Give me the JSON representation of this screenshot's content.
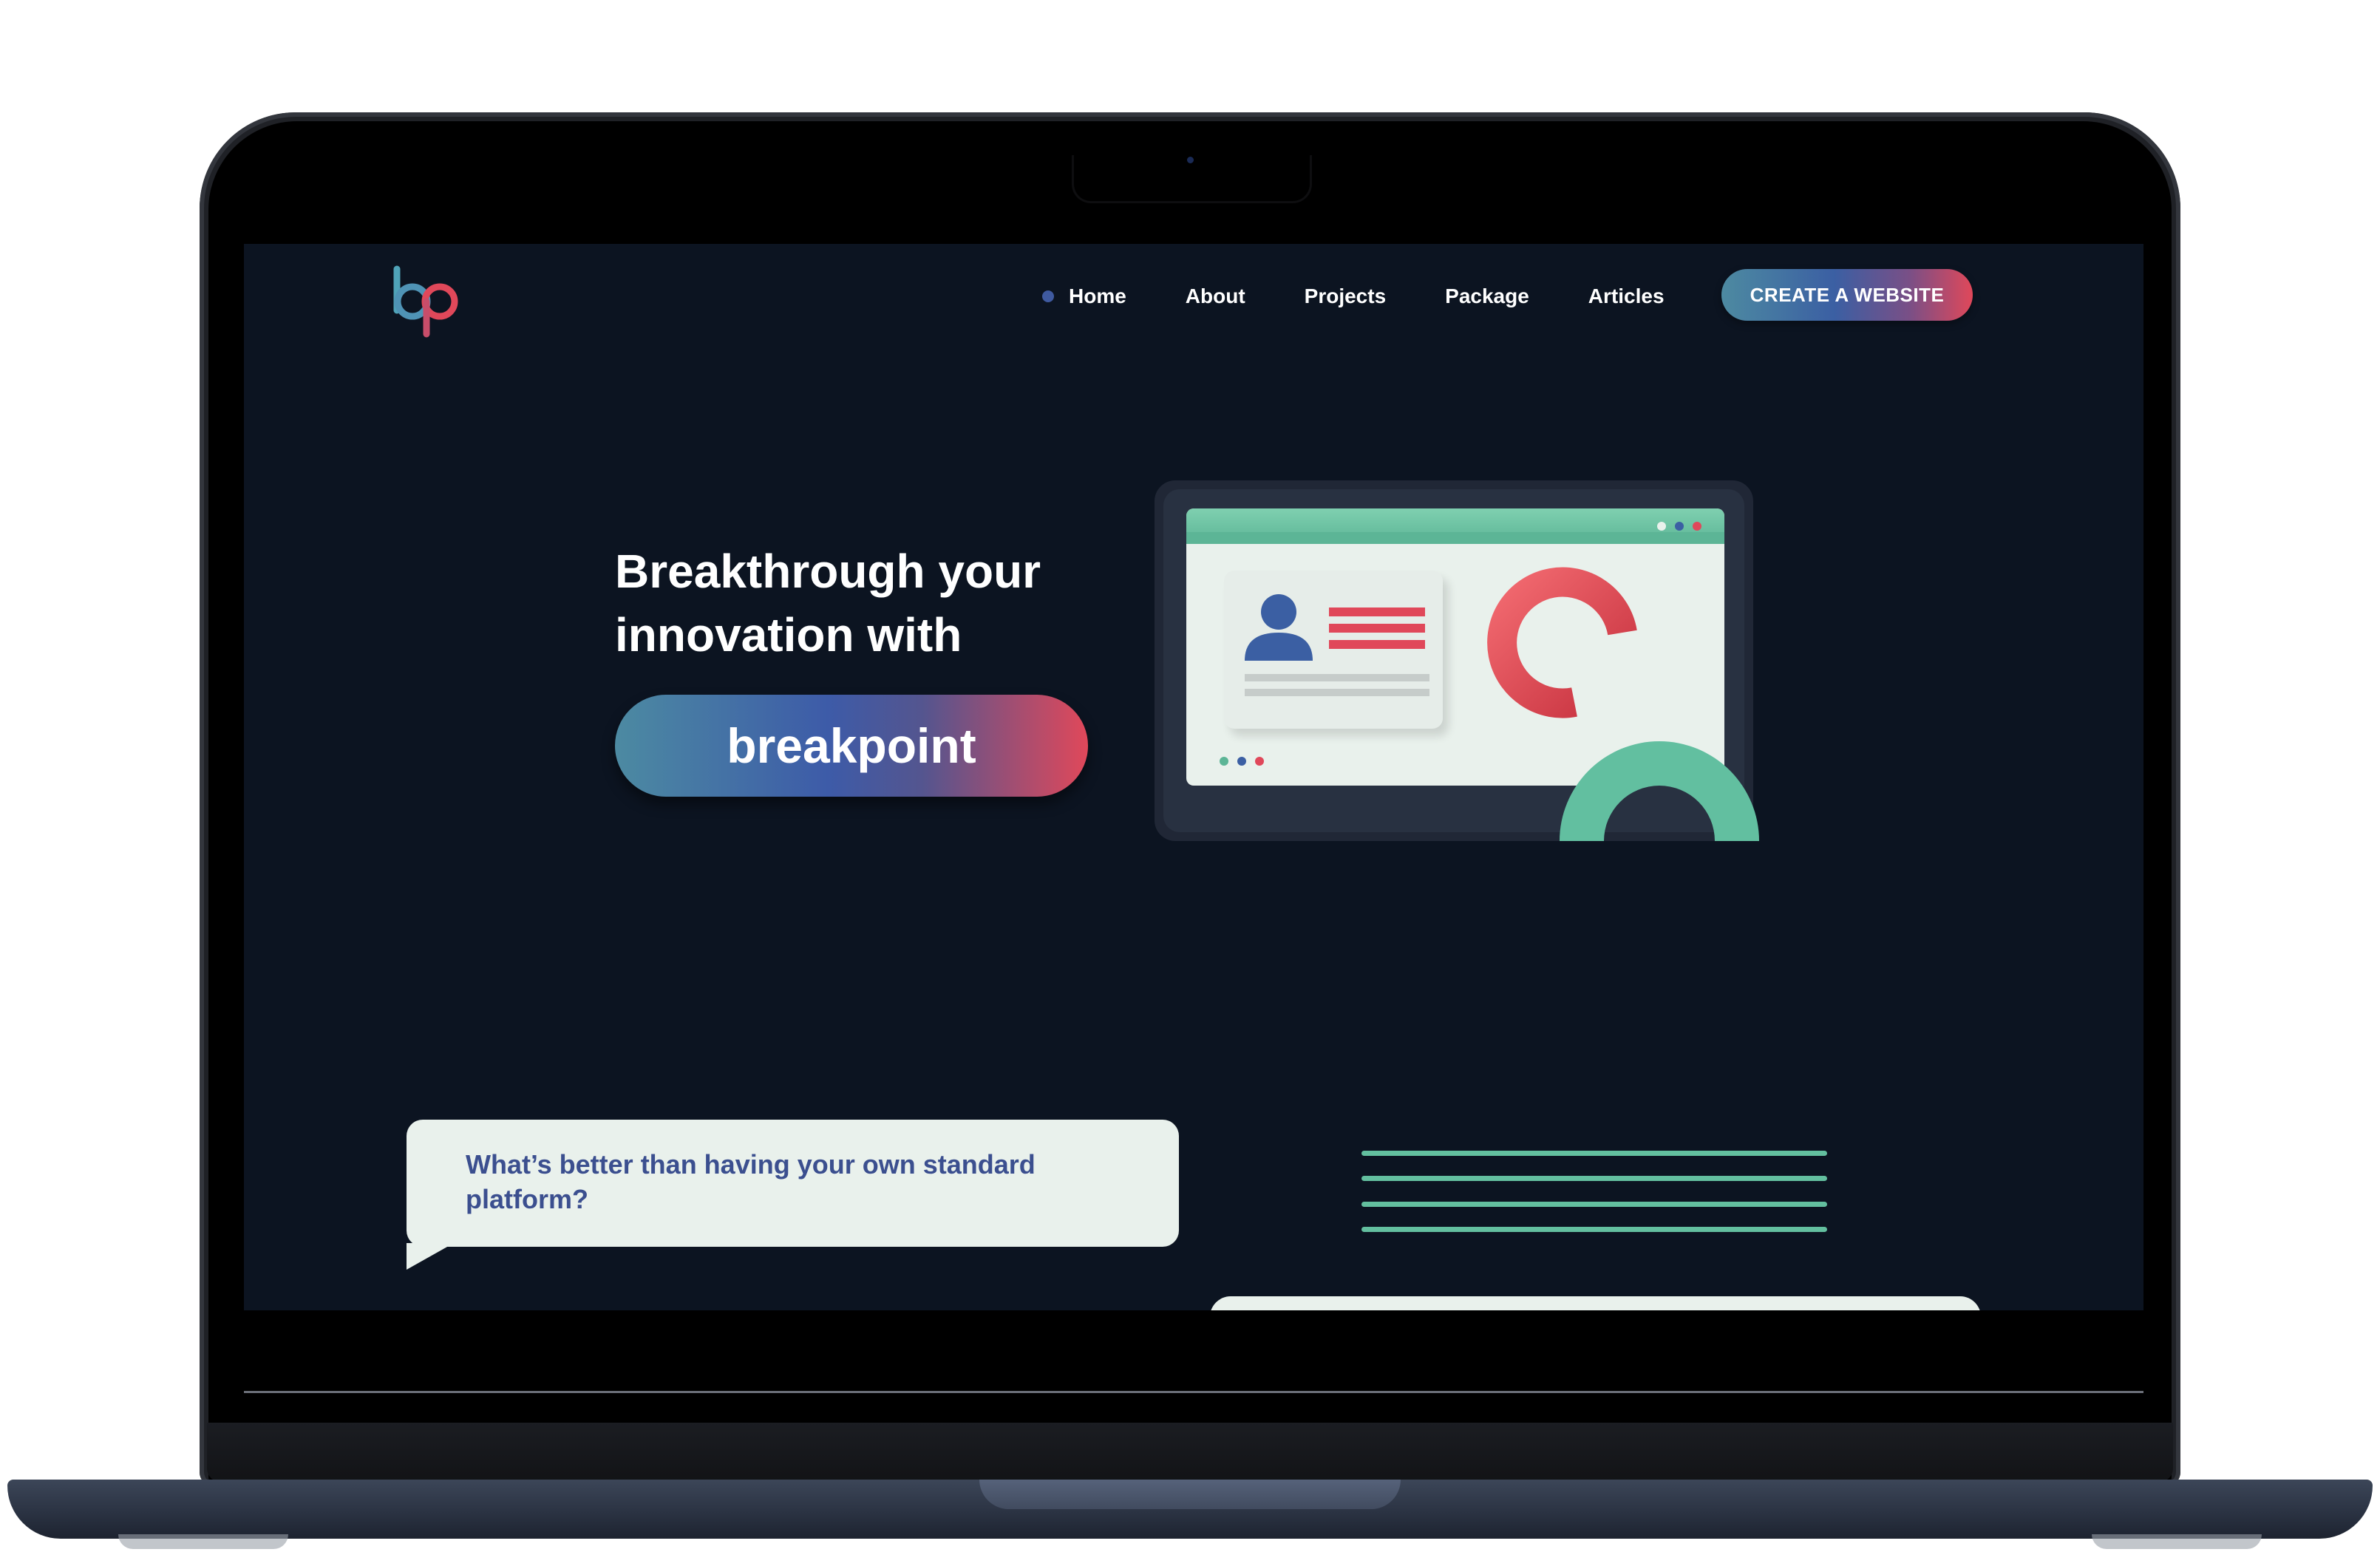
{
  "colors": {
    "screen_bg": "#0c1421",
    "accent_teal": "#63bf9f",
    "accent_blue": "#3b5fa3",
    "accent_red": "#e0485a",
    "light_surface": "#e9f1ec"
  },
  "logo": {
    "icon": "bp-logo-icon"
  },
  "nav": {
    "items": [
      {
        "label": "Home",
        "active": true
      },
      {
        "label": "About"
      },
      {
        "label": "Projects"
      },
      {
        "label": "Package"
      },
      {
        "label": "Articles"
      }
    ],
    "cta_label": "CREATE A WEBSITE"
  },
  "hero": {
    "title_line1": "Breakthrough your",
    "title_line2": "innovation with",
    "highlight": "breakpoint",
    "illustration": "dashboard-illustration"
  },
  "section2": {
    "bubble_text": "What’s better than having your own standard platform?"
  }
}
